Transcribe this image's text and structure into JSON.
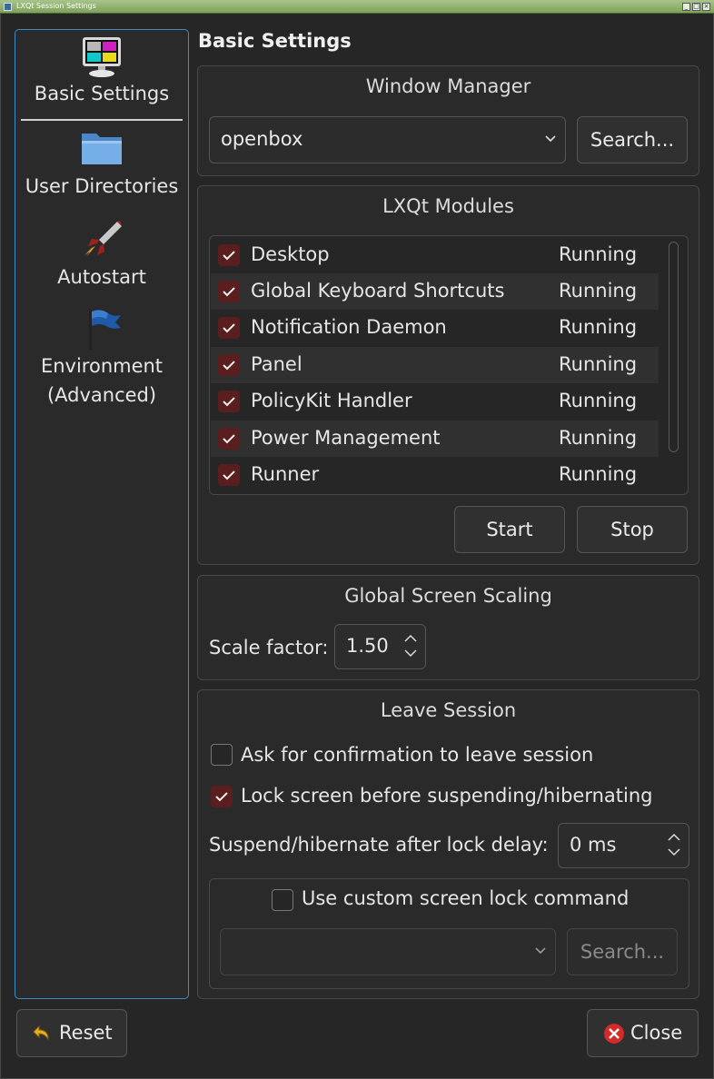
{
  "window": {
    "title": "LXQt Session Settings"
  },
  "sidebar": {
    "items": [
      {
        "label": "Basic Settings",
        "icon": "preferences-desktop-icon",
        "active": true
      },
      {
        "label": "User Directories",
        "icon": "folder-icon"
      },
      {
        "label": "Autostart",
        "icon": "rocket-icon"
      },
      {
        "label": "Environment\n(Advanced)",
        "icon": "flag-icon"
      }
    ]
  },
  "page": {
    "title": "Basic Settings"
  },
  "window_manager": {
    "title": "Window Manager",
    "value": "openbox",
    "search_label": "Search..."
  },
  "modules": {
    "title": "LXQt Modules",
    "rows": [
      {
        "name": "Desktop",
        "status": "Running",
        "checked": true
      },
      {
        "name": "Global Keyboard Shortcuts",
        "status": "Running",
        "checked": true
      },
      {
        "name": "Notification Daemon",
        "status": "Running",
        "checked": true
      },
      {
        "name": "Panel",
        "status": "Running",
        "checked": true
      },
      {
        "name": "PolicyKit Handler",
        "status": "Running",
        "checked": true
      },
      {
        "name": "Power Management",
        "status": "Running",
        "checked": true
      },
      {
        "name": "Runner",
        "status": "Running",
        "checked": true
      }
    ],
    "start_label": "Start",
    "stop_label": "Stop"
  },
  "scaling": {
    "title": "Global Screen Scaling",
    "label": "Scale factor:",
    "value": "1.50"
  },
  "leave": {
    "title": "Leave Session",
    "ask_confirm": {
      "label": "Ask for confirmation to leave session",
      "checked": false
    },
    "lock_screen": {
      "label": "Lock screen before suspending/hibernating",
      "checked": true
    },
    "delay_label": "Suspend/hibernate after lock delay:",
    "delay_value": "0 ms",
    "custom_lock": {
      "label": "Use custom screen lock command",
      "checked": false,
      "value": ""
    },
    "search_label": "Search..."
  },
  "footer": {
    "reset_label": "Reset",
    "close_label": "Close"
  },
  "colors": {
    "accent": "#3a8ec8",
    "check_bg": "#5a1e1e",
    "titlebar": "#8cae68",
    "close_icon": "#d42a2a",
    "reset_icon": "#e8b020"
  }
}
